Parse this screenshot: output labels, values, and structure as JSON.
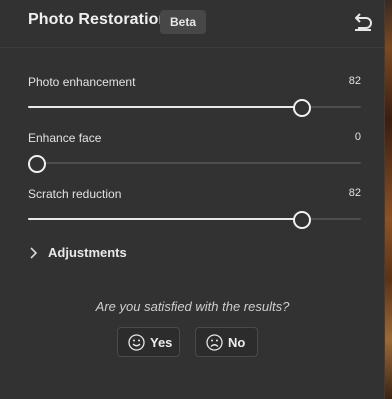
{
  "header": {
    "title": "Photo Restoration",
    "badge": "Beta",
    "reset_icon": "undo-arrow-icon"
  },
  "sliders": [
    {
      "label": "Photo enhancement",
      "value": "82",
      "fraction": 0.82
    },
    {
      "label": "Enhance face",
      "value": "0",
      "fraction": 0.0
    },
    {
      "label": "Scratch reduction",
      "value": "82",
      "fraction": 0.82
    }
  ],
  "adjustments": {
    "label": "Adjustments",
    "icon": "chevron-right-icon",
    "expanded": false
  },
  "feedback": {
    "question": "Are you satisfied with the results?",
    "yes_label": "Yes",
    "yes_icon": "smile-icon",
    "no_label": "No",
    "no_icon": "frown-icon"
  },
  "colors": {
    "panel_bg": "#323232",
    "track_fill": "#e9e9e9",
    "track_base": "#4e4e4e"
  }
}
